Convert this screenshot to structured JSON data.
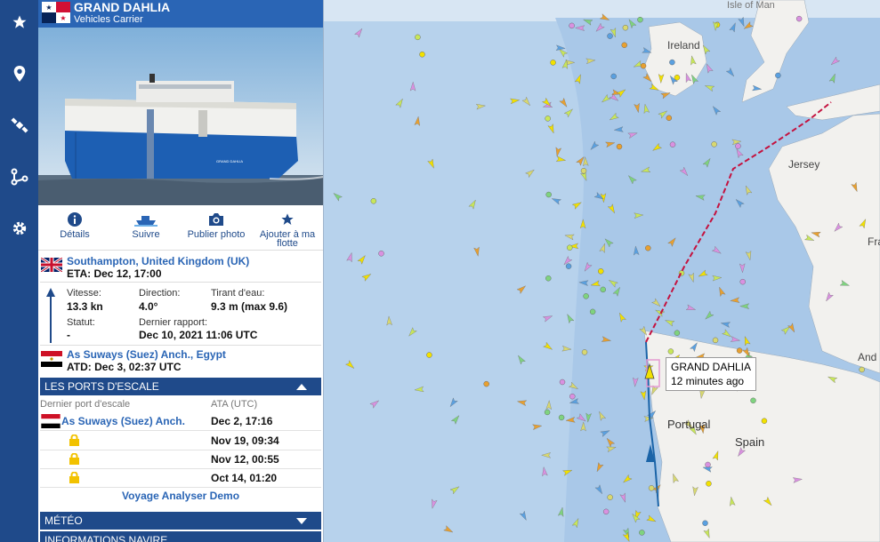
{
  "sidebar": {
    "icons": [
      "star-icon",
      "map-pin-icon",
      "satellite-icon",
      "route-icon",
      "gear-icon"
    ]
  },
  "vessel": {
    "name": "GRAND DAHLIA",
    "type": "Vehicles Carrier",
    "photo_text": "GRAND DAHLIA"
  },
  "actions": {
    "details": "Détails",
    "follow": "Suivre",
    "publish_photo": "Publier photo",
    "add_fleet": "Ajouter à ma flotte"
  },
  "destination": {
    "port": "Southampton, United Kingdom (UK)",
    "eta": "ETA: Dec 12, 17:00"
  },
  "stats": {
    "speed_label": "Vitesse:",
    "speed_value": "13.3 kn",
    "course_label": "Direction:",
    "course_value": "4.0°",
    "draught_label": "Tirant d'eau:",
    "draught_value": "9.3 m (max 9.6)",
    "status_label": "Statut:",
    "status_value": "-",
    "report_label": "Dernier rapport:",
    "report_value": "Dec 10, 2021 11:06 UTC"
  },
  "departure": {
    "port": "As Suways (Suez) Anch., Egypt",
    "atd": "ATD: Dec 3, 02:37 UTC"
  },
  "ports_section": {
    "title": "LES PORTS D'ESCALE",
    "col_port": "Dernier port d'escale",
    "col_ata": "ATA (UTC)",
    "rows": [
      {
        "port": "As Suways (Suez) Anch.",
        "ata": "Dec 2, 17:16"
      },
      {
        "port": "",
        "ata": "Nov 19, 09:34"
      },
      {
        "port": "",
        "ata": "Nov 12, 00:55"
      },
      {
        "port": "",
        "ata": "Oct 14, 01:20"
      }
    ],
    "voyage_link": "Voyage Analyser Demo"
  },
  "weather_section": {
    "title": "MÉTÉO"
  },
  "info_section": {
    "title": "INFORMATIONS NAVIRE"
  },
  "map": {
    "labels": {
      "isle_of_man": "Isle of Man",
      "ireland": "Ireland",
      "jersey": "Jersey",
      "france": "Fra",
      "andorra": "And",
      "portugal": "Portugal",
      "spain": "Spain"
    },
    "tooltip_name": "GRAND DAHLIA",
    "tooltip_time": "12 minutes ago"
  },
  "colors": {
    "rail": "#1f4a8a",
    "header": "#2a65b5",
    "sea": "#b7d2ec",
    "land": "#f2f1ee",
    "route": "#c4123f"
  }
}
